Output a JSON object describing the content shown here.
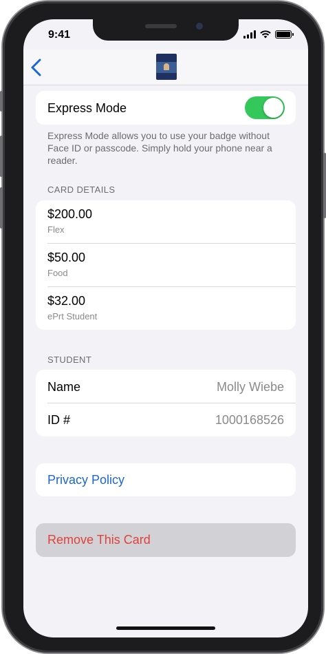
{
  "status_bar": {
    "time": "9:41"
  },
  "navbar": {
    "back_icon": "chevron-left-icon",
    "card_icon": "badge-card-thumbnail"
  },
  "express": {
    "label": "Express Mode",
    "enabled": true,
    "footnote": "Express Mode allows you to use your badge without Face ID or passcode. Simply hold your phone near a reader."
  },
  "card_details": {
    "header": "CARD DETAILS",
    "items": [
      {
        "amount": "$200.00",
        "name": "Flex"
      },
      {
        "amount": "$50.00",
        "name": "Food"
      },
      {
        "amount": "$32.00",
        "name": "ePrt Student"
      }
    ]
  },
  "student": {
    "header": "STUDENT",
    "name_label": "Name",
    "name_value": "Molly Wiebe",
    "id_label": "ID #",
    "id_value": "1000168526"
  },
  "privacy_link": "Privacy Policy",
  "remove_label": "Remove This Card",
  "colors": {
    "accent": "#1a66d2",
    "toggle_on": "#34c759",
    "destructive": "#e0423b"
  }
}
